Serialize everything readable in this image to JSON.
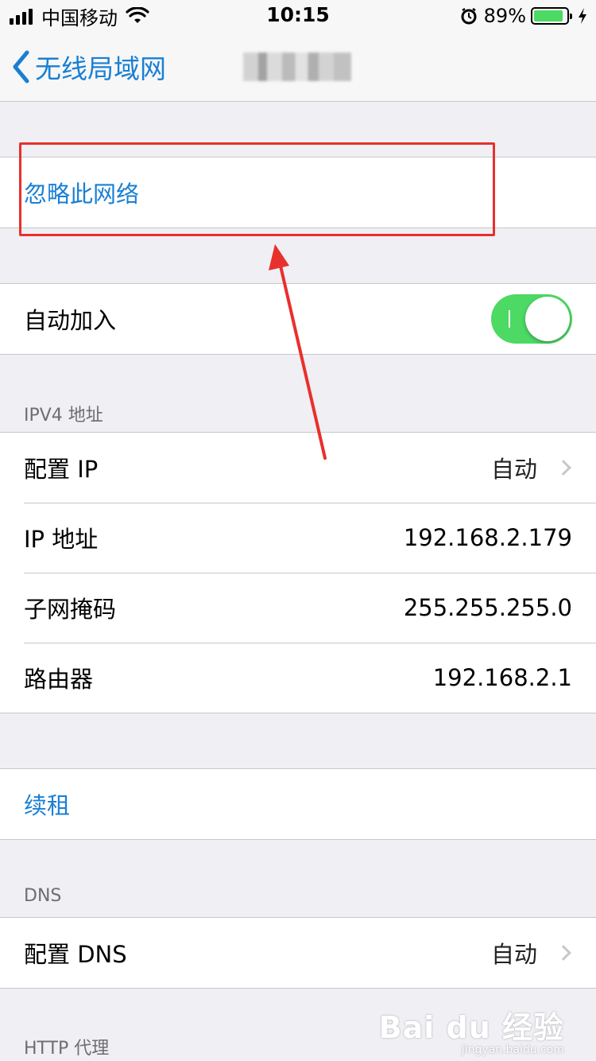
{
  "status_bar": {
    "carrier": "中国移动",
    "time": "10:15",
    "battery_percent": "89%"
  },
  "nav": {
    "back_label": "无线局域网"
  },
  "rows": {
    "forget_network": "忽略此网络",
    "auto_join": "自动加入",
    "auto_join_state": "on",
    "ipv4_header": "IPV4 地址",
    "configure_ip_label": "配置 IP",
    "configure_ip_value": "自动",
    "ip_address_label": "IP 地址",
    "ip_address_value": "192.168.2.179",
    "subnet_label": "子网掩码",
    "subnet_value": "255.255.255.0",
    "router_label": "路由器",
    "router_value": "192.168.2.1",
    "renew_lease": "续租",
    "dns_header": "DNS",
    "configure_dns_label": "配置 DNS",
    "configure_dns_value": "自动",
    "http_proxy_header": "HTTP 代理"
  },
  "watermark": {
    "main": "Bai du 经验",
    "sub": "jingyan.baidu.com"
  },
  "colors": {
    "accent": "#1a7fd4",
    "toggle_on": "#4cd964",
    "annotation_red": "#e8302c"
  }
}
